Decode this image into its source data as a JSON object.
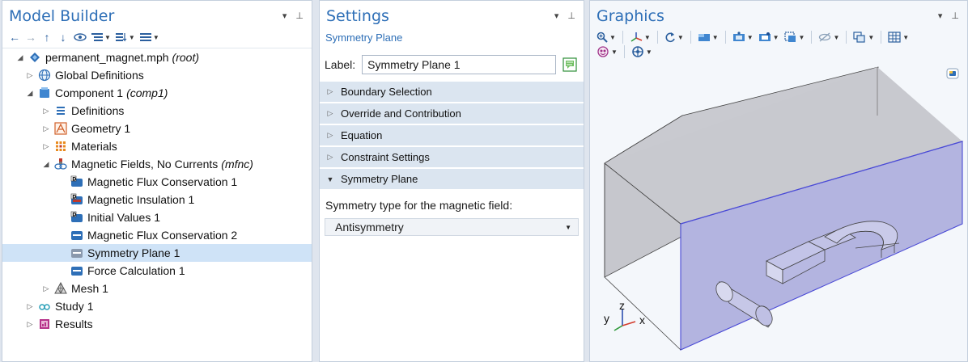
{
  "model_builder": {
    "title": "Model Builder",
    "tree": [
      {
        "label": "permanent_magnet.mph",
        "tag": "(root)"
      },
      {
        "label": "Global Definitions",
        "tag": ""
      },
      {
        "label": "Component 1",
        "tag": "(comp1)"
      },
      {
        "label": "Definitions",
        "tag": ""
      },
      {
        "label": "Geometry 1",
        "tag": ""
      },
      {
        "label": "Materials",
        "tag": ""
      },
      {
        "label": "Magnetic Fields, No Currents",
        "tag": "(mfnc)"
      },
      {
        "label": "Magnetic Flux Conservation 1",
        "tag": ""
      },
      {
        "label": "Magnetic Insulation 1",
        "tag": ""
      },
      {
        "label": "Initial Values 1",
        "tag": ""
      },
      {
        "label": "Magnetic Flux Conservation 2",
        "tag": ""
      },
      {
        "label": "Symmetry Plane 1",
        "tag": ""
      },
      {
        "label": "Force Calculation 1",
        "tag": ""
      },
      {
        "label": "Mesh 1",
        "tag": ""
      },
      {
        "label": "Study 1",
        "tag": ""
      },
      {
        "label": "Results",
        "tag": ""
      }
    ]
  },
  "settings": {
    "title": "Settings",
    "subtitle": "Symmetry Plane",
    "label_caption": "Label:",
    "label_value": "Symmetry Plane 1",
    "sections": [
      {
        "label": "Boundary Selection"
      },
      {
        "label": "Override and Contribution"
      },
      {
        "label": "Equation"
      },
      {
        "label": "Constraint Settings"
      },
      {
        "label": "Symmetry Plane"
      }
    ],
    "symmetry_type_label": "Symmetry type for the magnetic field:",
    "symmetry_type_value": "Antisymmetry"
  },
  "graphics": {
    "title": "Graphics",
    "axes": {
      "x": "x",
      "y": "y",
      "z": "z"
    }
  },
  "colors": {
    "accent": "#2e6fb7",
    "selection": "#cfe3f7",
    "section_header": "#dbe5f0",
    "highlight_face": "#8c8fd9",
    "axis_x": "#d33b2c",
    "axis_y": "#2f9a3a",
    "axis_z": "#2b4fb0"
  }
}
